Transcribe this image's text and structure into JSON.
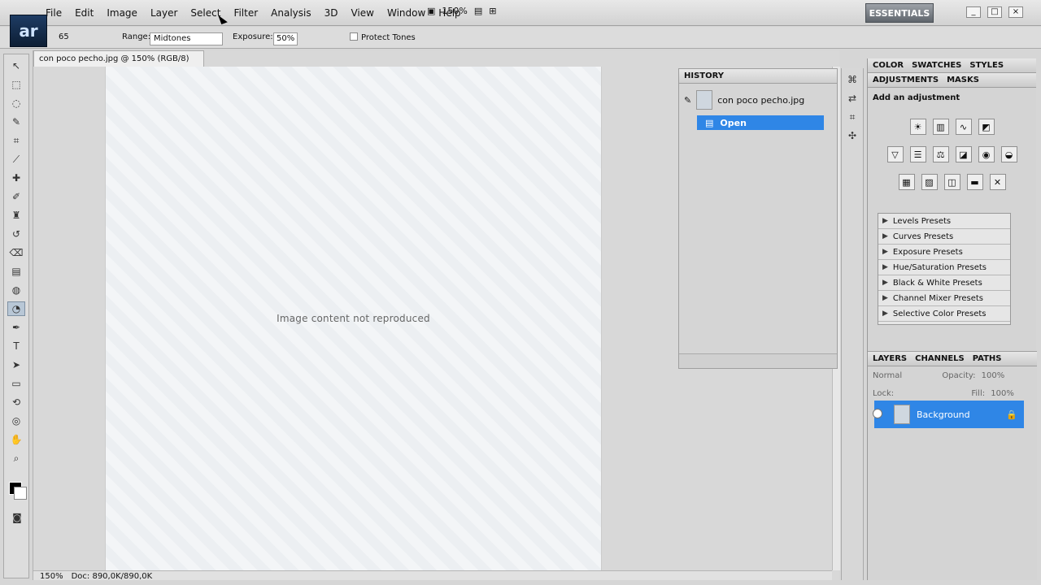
{
  "logo_text": "ar",
  "menu": [
    "File",
    "Edit",
    "Image",
    "Layer",
    "Select",
    "Filter",
    "Analysis",
    "3D",
    "View",
    "Window",
    "Help"
  ],
  "zoom_top": "150%",
  "workspace": "ESSENTIALS",
  "options": {
    "brush_size": "65",
    "range_label": "Range:",
    "range_value": "Midtones",
    "exposure_label": "Exposure:",
    "exposure_value": "50%",
    "protect_tones": "Protect Tones"
  },
  "document": {
    "tab": "con poco pecho.jpg @ 150% (RGB/8)",
    "placeholder": "Image content not reproduced",
    "zoom": "150%",
    "doc": "Doc: 890,0K/890,0K"
  },
  "history": {
    "title": "HISTORY",
    "file": "con poco pecho.jpg",
    "step": "Open"
  },
  "top_tabs": [
    "COLOR",
    "SWATCHES",
    "STYLES"
  ],
  "adj_tabs": [
    "ADJUSTMENTS",
    "MASKS"
  ],
  "add_adjustment": "Add an adjustment",
  "presets": [
    "Levels Presets",
    "Curves Presets",
    "Exposure Presets",
    "Hue/Saturation Presets",
    "Black & White Presets",
    "Channel Mixer Presets",
    "Selective Color Presets"
  ],
  "layer_tabs": [
    "LAYERS",
    "CHANNELS",
    "PATHS"
  ],
  "layers": {
    "blend": "Normal",
    "opacity": "100%",
    "fill": "100%",
    "lock": "Lock:",
    "opacity_label": "Opacity:",
    "fill_label": "Fill:",
    "name": "Background"
  }
}
